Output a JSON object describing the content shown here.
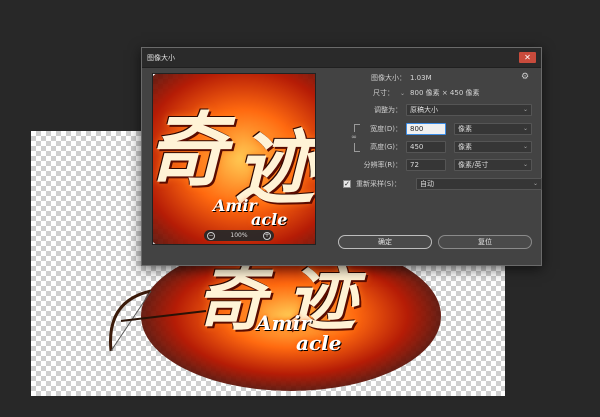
{
  "dialog": {
    "title": "图像大小",
    "close_glyph": "✕",
    "image_size_label": "图像大小：",
    "image_size_value": "1.03M",
    "settings_glyph": "⚙",
    "dimensions_label": "尺寸：",
    "dimensions_value": "800 像素 × 450 像素",
    "fit_to_label": "调整为：",
    "fit_to_value": "原稿大小",
    "width_label": "宽度(D)：",
    "width_value": "800",
    "width_unit": "像素",
    "height_label": "高度(G)：",
    "height_value": "450",
    "height_unit": "像素",
    "resolution_label": "分辨率(R)：",
    "resolution_value": "72",
    "resolution_unit": "像素/英寸",
    "resample_label": "重新采样(S)：",
    "resample_checked": "✓",
    "resample_value": "自动",
    "ok_label": "确定",
    "reset_label": "复位",
    "zoom_level": "100%",
    "zoom_out_glyph": "−",
    "zoom_in_glyph": "+",
    "link_glyph": "∞",
    "chevron": "⌄"
  },
  "artwork": {
    "chars": [
      "奇",
      "迹"
    ],
    "latin_1": "Amir",
    "latin_2": "acle"
  }
}
